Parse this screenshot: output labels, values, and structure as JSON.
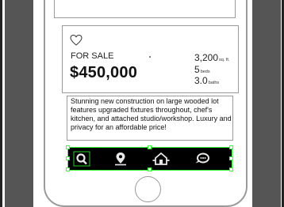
{
  "listing": {
    "status": "FOR SALE",
    "price": "$450,000",
    "sqft_value": "3,200",
    "sqft_unit": "sq. ft.",
    "beds_value": "5",
    "beds_unit": "beds",
    "baths_value": "3.0",
    "baths_unit": "baths",
    "favorite_icon": "heart-icon"
  },
  "description": {
    "text": "Stunning new construction on large wooded lot features upgraded fixtures throughout, chef's kitchen, and attached studio/workshop. Luxury and privacy for an affordable price!"
  },
  "action_bar": {
    "icons": [
      "search-icon",
      "location-pin-icon",
      "home-network-icon",
      "chat-icon"
    ]
  },
  "colors": {
    "selection_green": "#33ff33",
    "action_bar_bg": "#000000",
    "frame_gray": "#9a9a9a",
    "side_bar_gray": "#555555"
  }
}
